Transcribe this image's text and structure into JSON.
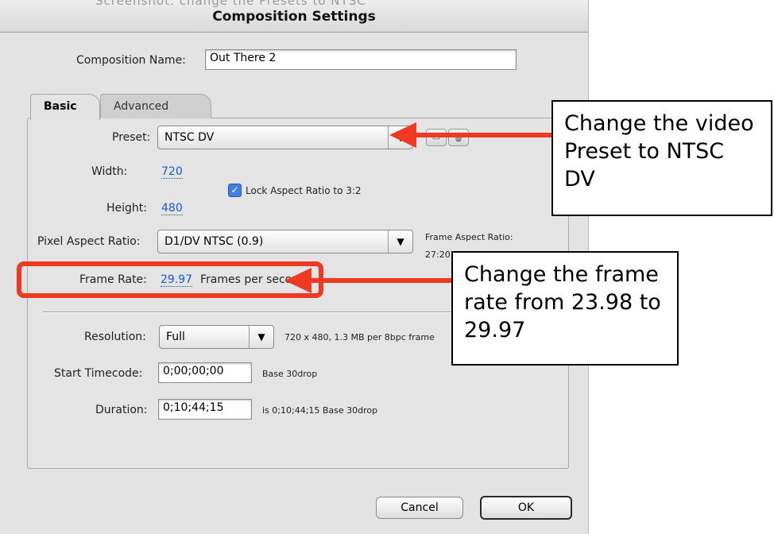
{
  "window": {
    "title": "Composition Settings",
    "title_ghost": "Screenshot: change the Presets to NTSC"
  },
  "comp_name": {
    "label": "Composition Name:",
    "value": "Out There 2"
  },
  "tabs": [
    {
      "label": "Basic",
      "active": true
    },
    {
      "label": "Advanced",
      "active": false
    }
  ],
  "basic": {
    "preset": {
      "label": "Preset:",
      "value": "NTSC DV"
    },
    "width": {
      "label": "Width:",
      "value": "720"
    },
    "height": {
      "label": "Height:",
      "value": "480"
    },
    "lock_aspect": {
      "label": "Lock Aspect Ratio to 3:2",
      "checked": true
    },
    "pixel_aspect": {
      "label": "Pixel Aspect Ratio:",
      "value": "D1/DV NTSC (0.9)"
    },
    "frame_aspect": {
      "label": "Frame Aspect Ratio:",
      "value": "27:20"
    },
    "frame_rate": {
      "label": "Frame Rate:",
      "value": "29.97",
      "unit": "Frames per second"
    },
    "resolution": {
      "label": "Resolution:",
      "value": "Full",
      "info": "720 x 480, 1.3 MB per 8bpc frame"
    },
    "start_timecode": {
      "label": "Start Timecode:",
      "value": "0;00;00;00",
      "note": "Base 30drop"
    },
    "duration": {
      "label": "Duration:",
      "value": "0;10;44;15",
      "note": "is 0;10;44;15  Base 30drop"
    }
  },
  "buttons": {
    "cancel": "Cancel",
    "ok": "OK"
  },
  "annotations": {
    "callout_preset": "Change the video Preset to NTSC DV",
    "callout_framerate": "Change the frame rate from 23.98 to 29.97",
    "arrow_color": "#ee3a22"
  },
  "icons": {
    "dropdown": "chevron-down-icon",
    "save_preset": "save-preset-icon",
    "delete_preset": "trash-icon",
    "check": "checkmark-icon"
  }
}
